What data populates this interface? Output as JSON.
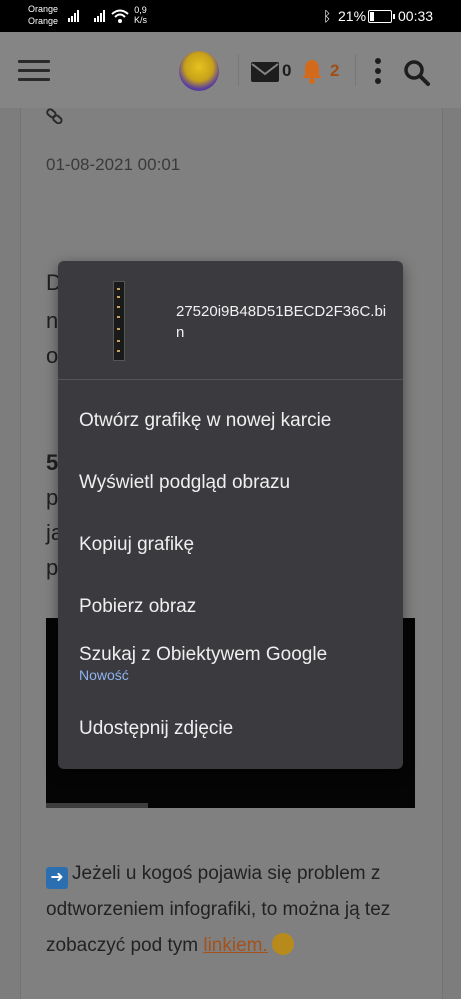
{
  "status_bar": {
    "carrier_1": "Orange",
    "carrier_2": "Orange",
    "speed_value": "0,9",
    "speed_unit": "K/s",
    "battery_percent": "21%",
    "battery_level": 0.21,
    "time": "00:33"
  },
  "header": {
    "messages_count": "0",
    "notifications_count": "2",
    "accent_color": "#e8701e"
  },
  "post": {
    "date": "01-08-2021 00:01",
    "bottom_text_before": "Jeżeli u kogoś pojawia się problem z odtworzeniem infografiki, to można ją tez zobaczyć pod tym ",
    "bottom_link": "linkiem.",
    "visible_fragments": [
      "D",
      "n",
      "o",
      "5",
      "p",
      "ja",
      "p"
    ]
  },
  "context_menu": {
    "file_name": "27520i9B48D51BECD2F36C.bin",
    "items": [
      "Otwórz grafikę w nowej karcie",
      "Wyświetl podgląd obrazu",
      "Kopiuj grafikę",
      "Pobierz obraz",
      "Szukaj z Obiektywem Google",
      "Udostępnij zdjęcie"
    ],
    "new_badge": "Nowość"
  }
}
